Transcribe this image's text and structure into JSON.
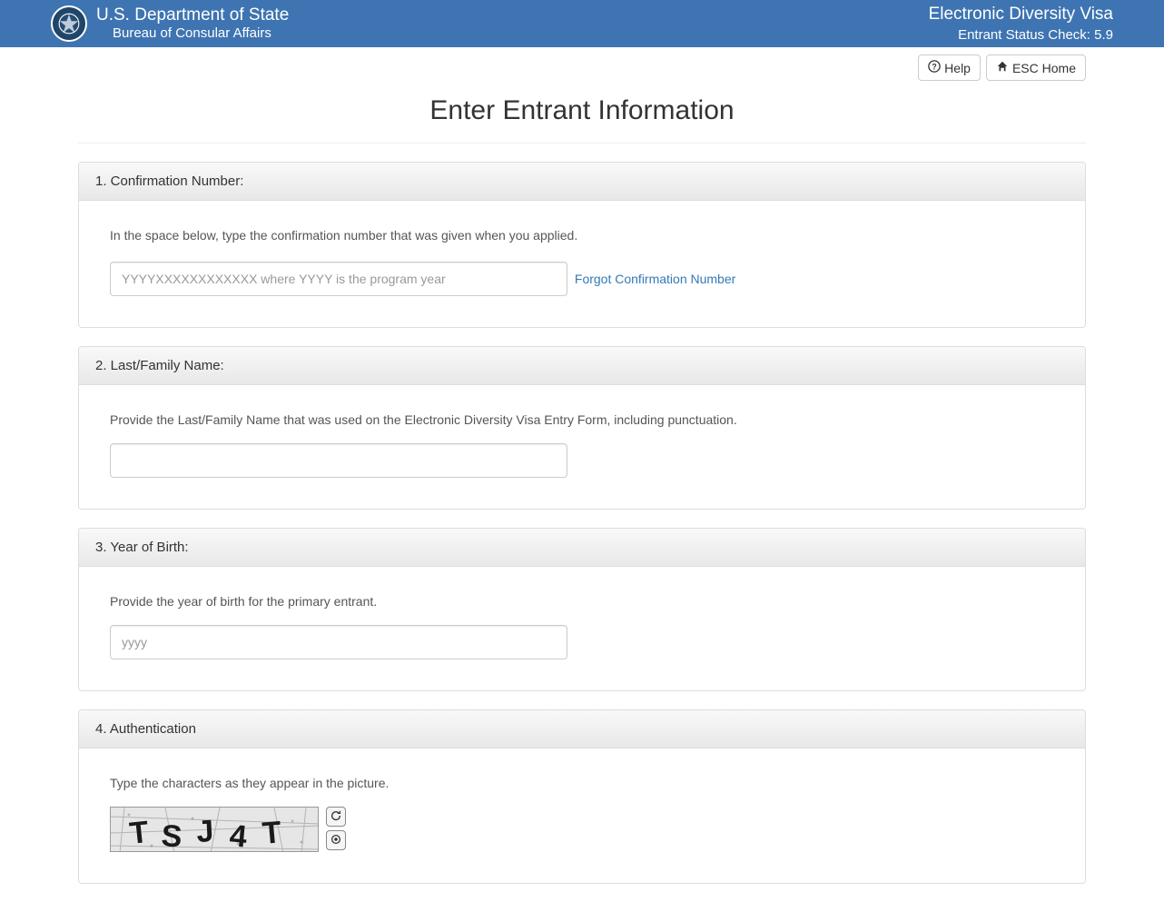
{
  "header": {
    "title": "U.S. Department of State",
    "subtitle": "Bureau of Consular Affairs",
    "right_title": "Electronic Diversity Visa",
    "right_subtitle": "Entrant Status Check: 5.9"
  },
  "buttons": {
    "help": "Help",
    "home": "ESC Home"
  },
  "page_title": "Enter Entrant Information",
  "section1": {
    "heading": "1. Confirmation Number:",
    "desc": "In the space below, type the confirmation number that was given when you applied.",
    "placeholder": "YYYYXXXXXXXXXXXX where YYYY is the program year",
    "forgot_link": "Forgot Confirmation Number"
  },
  "section2": {
    "heading": "2. Last/Family Name:",
    "desc": "Provide the Last/Family Name that was used on the Electronic Diversity Visa Entry Form, including punctuation."
  },
  "section3": {
    "heading": "3. Year of Birth:",
    "desc": "Provide the year of birth for the primary entrant.",
    "placeholder": "yyyy"
  },
  "section4": {
    "heading": "4. Authentication",
    "desc": "Type the characters as they appear in the picture.",
    "captcha_text": "TSJ4T"
  }
}
